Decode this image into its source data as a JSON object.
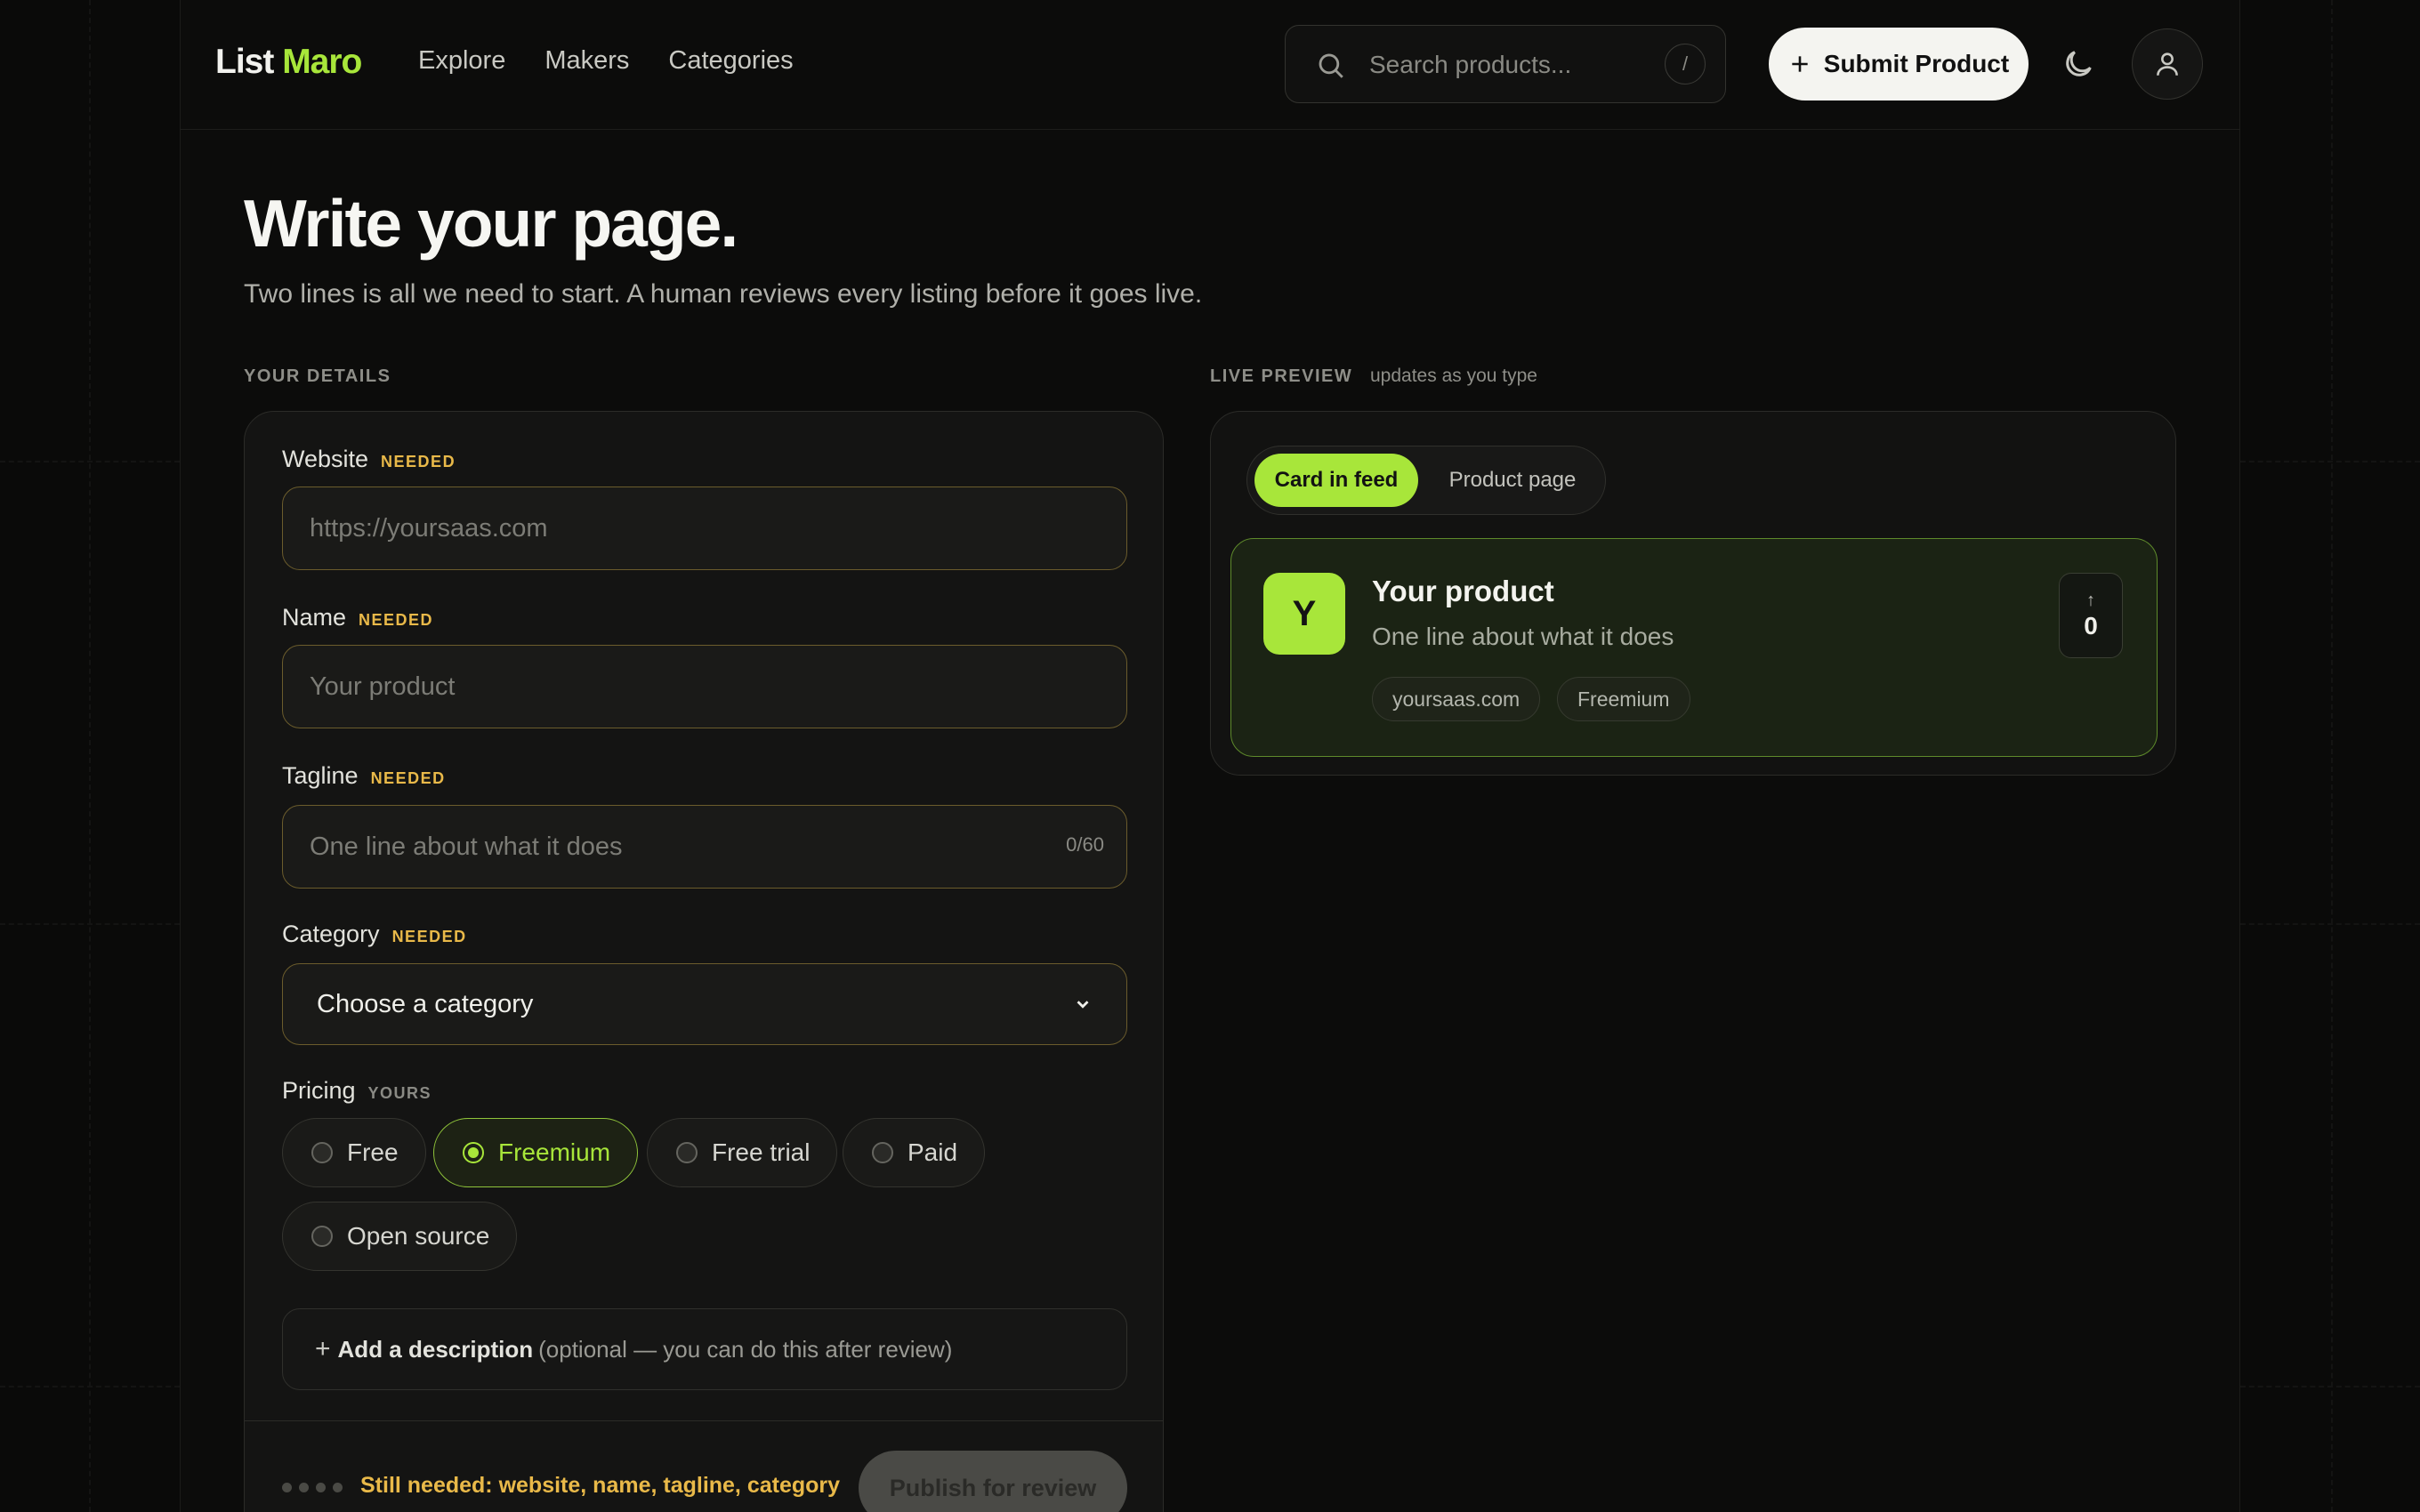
{
  "header": {
    "logo_first": "List",
    "logo_second": "Maro",
    "nav": [
      "Explore",
      "Makers",
      "Categories"
    ],
    "search_placeholder": "Search products...",
    "search_shortcut": "/",
    "submit_label": "Submit Product"
  },
  "page": {
    "title": "Write your page.",
    "subtitle": "Two lines is all we need to start. A human reviews every listing before it goes live."
  },
  "form": {
    "section_label": "YOUR DETAILS",
    "website_label": "Website",
    "website_placeholder": "https://yoursaas.com",
    "name_label": "Name",
    "name_placeholder": "Your product",
    "tagline_label": "Tagline",
    "tagline_placeholder": "One line about what it does",
    "tagline_counter": "0/60",
    "category_label": "Category",
    "category_value": "Choose a category",
    "needed_badge": "NEEDED",
    "pricing_label": "Pricing",
    "pricing_badge": "YOURS",
    "pricing_options": [
      "Free",
      "Freemium",
      "Free trial",
      "Paid",
      "Open source"
    ],
    "pricing_selected": "Freemium",
    "description_plus": "+",
    "description_label": "Add a description",
    "description_note": "(optional — you can do this after review)",
    "still_needed": "Still needed: website, name, tagline, category",
    "publish_label": "Publish for review"
  },
  "preview": {
    "section_label": "LIVE PREVIEW",
    "section_note": "updates as you type",
    "tabs": [
      "Card in feed",
      "Product page"
    ],
    "card": {
      "logo_letter": "Y",
      "name": "Your product",
      "tagline": "One line about what it does",
      "chips": [
        "yoursaas.com",
        "Freemium"
      ],
      "votes": "0",
      "vote_arrow": "↑"
    }
  },
  "colors": {
    "accent": "#a8e63a",
    "needed": "#e9b949",
    "background": "#0c0c0b"
  }
}
